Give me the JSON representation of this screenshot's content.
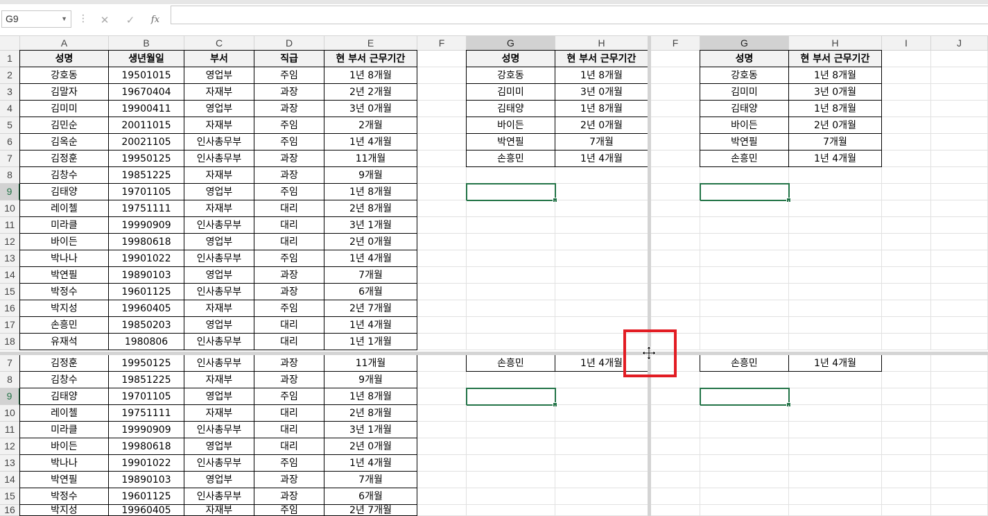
{
  "formula_bar": {
    "name_box": "G9",
    "cancel_icon": "✕",
    "enter_icon": "✓",
    "fx_label": "fx",
    "formula": ""
  },
  "columns_left": [
    "A",
    "B",
    "C",
    "D",
    "E",
    "F",
    "G",
    "H"
  ],
  "columns_right": [
    "F",
    "G",
    "H",
    "I",
    "J"
  ],
  "main_table": {
    "headers": [
      "성명",
      "생년월일",
      "부서",
      "직급",
      "현 부서 근무기간"
    ],
    "rows": [
      [
        "강호동",
        "19501015",
        "영업부",
        "주임",
        "1년 8개월"
      ],
      [
        "김말자",
        "19670404",
        "자재부",
        "과장",
        "2년 2개월"
      ],
      [
        "김미미",
        "19900411",
        "영업부",
        "과장",
        "3년 0개월"
      ],
      [
        "김민순",
        "20011015",
        "자재부",
        "주임",
        "2개월"
      ],
      [
        "김옥순",
        "20021105",
        "인사총무부",
        "주임",
        "1년 4개월"
      ],
      [
        "김정훈",
        "19950125",
        "인사총무부",
        "과장",
        "11개월"
      ],
      [
        "김창수",
        "19851225",
        "자재부",
        "과장",
        "9개월"
      ],
      [
        "김태양",
        "19701105",
        "영업부",
        "주임",
        "1년 8개월"
      ],
      [
        "레이첼",
        "19751111",
        "자재부",
        "대리",
        "2년 8개월"
      ],
      [
        "미라클",
        "19990909",
        "인사총무부",
        "대리",
        "3년 1개월"
      ],
      [
        "바이든",
        "19980618",
        "영업부",
        "대리",
        "2년 0개월"
      ],
      [
        "박나나",
        "19901022",
        "인사총무부",
        "주임",
        "1년 4개월"
      ],
      [
        "박연필",
        "19890103",
        "영업부",
        "과장",
        "7개월"
      ],
      [
        "박정수",
        "19601125",
        "인사총무부",
        "과장",
        "6개월"
      ],
      [
        "박지성",
        "19960405",
        "자재부",
        "주임",
        "2년 7개월"
      ],
      [
        "손흥민",
        "19850203",
        "영업부",
        "대리",
        "1년 4개월"
      ],
      [
        "유재석",
        "1980806",
        "인사총무부",
        "대리",
        "1년 1개월"
      ]
    ]
  },
  "lookup_table": {
    "headers": [
      "성명",
      "현 부서 근무기간"
    ],
    "rows": [
      [
        "강호동",
        "1년 8개월"
      ],
      [
        "김미미",
        "3년 0개월"
      ],
      [
        "김태양",
        "1년 8개월"
      ],
      [
        "바이든",
        "2년 0개월"
      ],
      [
        "박연필",
        "7개월"
      ],
      [
        "손흥민",
        "1년 4개월"
      ]
    ]
  },
  "top_row_numbers": [
    "1",
    "2",
    "3",
    "4",
    "5",
    "6",
    "7",
    "8",
    "9",
    "10",
    "11",
    "12",
    "13",
    "14",
    "15",
    "16",
    "17",
    "18"
  ],
  "bottom_row_numbers": [
    "7",
    "8",
    "9",
    "10",
    "11",
    "12",
    "13",
    "14",
    "15",
    "16"
  ],
  "selected_cell": "G9",
  "accent_color": "#217346",
  "highlight_color": "#e21c23",
  "cursor_icon": "move-cursor-icon"
}
